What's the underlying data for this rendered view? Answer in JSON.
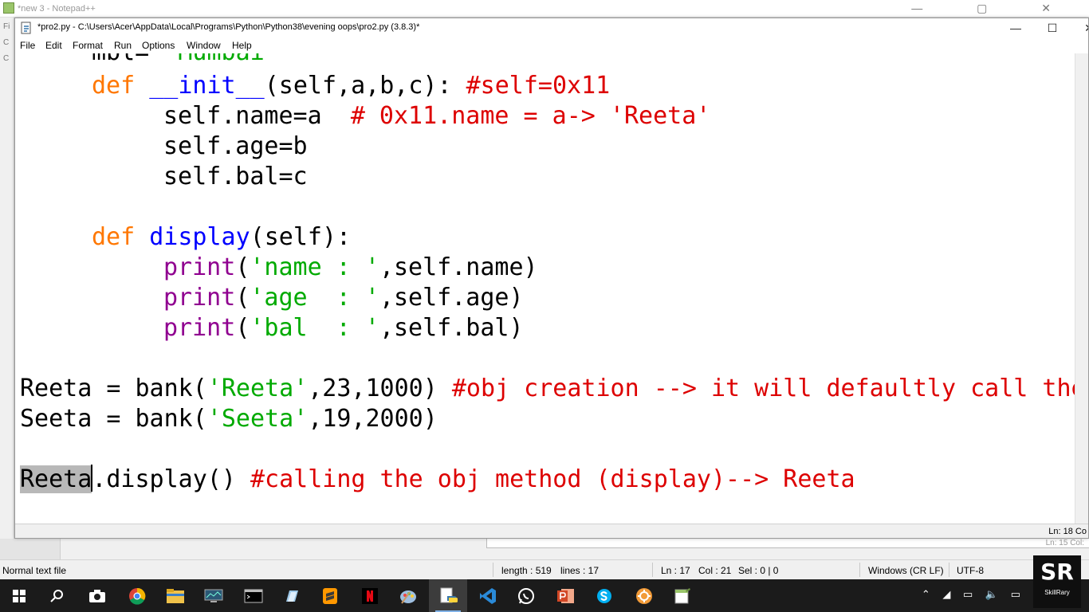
{
  "npp": {
    "title": "*new 3 - Notepad++",
    "left_markers": [
      "Fi",
      "C",
      "C"
    ],
    "controls": "— ▢ ✕",
    "peek_right": "Ln: 15   Col:"
  },
  "idle": {
    "title": "*pro2.py - C:\\Users\\Acer\\AppData\\Local\\Programs\\Python\\Python38\\evening oops\\pro2.py (3.8.3)*",
    "minimize": "—",
    "maximize": "☐",
    "close": "✕",
    "menu": [
      "File",
      "Edit",
      "Format",
      "Run",
      "Options",
      "Window",
      "Help"
    ],
    "status_ln": "Ln: 18   Co",
    "code": {
      "l0_a": "mbl= ",
      "l0_b": "'Mumbai'",
      "l1_def": "def",
      "l1_name": "__init__",
      "l1_args": "(self,a,b,c): ",
      "l1_comment": "#self=0x11",
      "l2_code": "self.name=a  ",
      "l2_comment": "# 0x11.name = a-> 'Reeta'",
      "l3": "self.age=b",
      "l4": "self.bal=c",
      "l5_def": "def",
      "l5_name": "display",
      "l5_args": "(self):",
      "p1_print": "print",
      "p1_open": "(",
      "p1_str": "'name : '",
      "p1_rest": ",self.name)",
      "p2_print": "print",
      "p2_open": "(",
      "p2_str": "'age  : '",
      "p2_rest": ",self.age)",
      "p3_print": "print",
      "p3_open": "(",
      "p3_str": "'bal  : '",
      "p3_rest": ",self.bal)",
      "r1_a": "Reeta = bank(",
      "r1_str": "'Reeta'",
      "r1_b": ",23,1000) ",
      "r1_comment": "#obj creation --> it will defaultly call the",
      "r2_a": "Seeta = bank(",
      "r2_str": "'Seeta'",
      "r2_b": ",19,2000)",
      "r3_sel": "Reeta",
      "r3_b": ".display() ",
      "r3_comment": "#calling the obj method (display)--> Reeta"
    }
  },
  "statusbar": {
    "file_type": "Normal text file",
    "length": "length : 519",
    "lines": "lines : 17",
    "ln": "Ln : 17",
    "col": "Col : 21",
    "sel": "Sel : 0 | 0",
    "eol": "Windows (CR LF)",
    "encoding": "UTF-8"
  },
  "taskbar": {
    "apps": [
      "windows-start",
      "search",
      "camera",
      "chrome",
      "file-explorer",
      "monitor",
      "terminal",
      "notes",
      "sublime-text",
      "netflix",
      "paint",
      "python-idle",
      "vscode",
      "whatsapp",
      "powerpoint",
      "skype",
      "gear-app",
      "notepad-plus-plus"
    ],
    "tray": "⌃ ◢ ▭ 🔈 ▭"
  },
  "logo": {
    "letters": "SR",
    "caption": "SkillRary"
  }
}
